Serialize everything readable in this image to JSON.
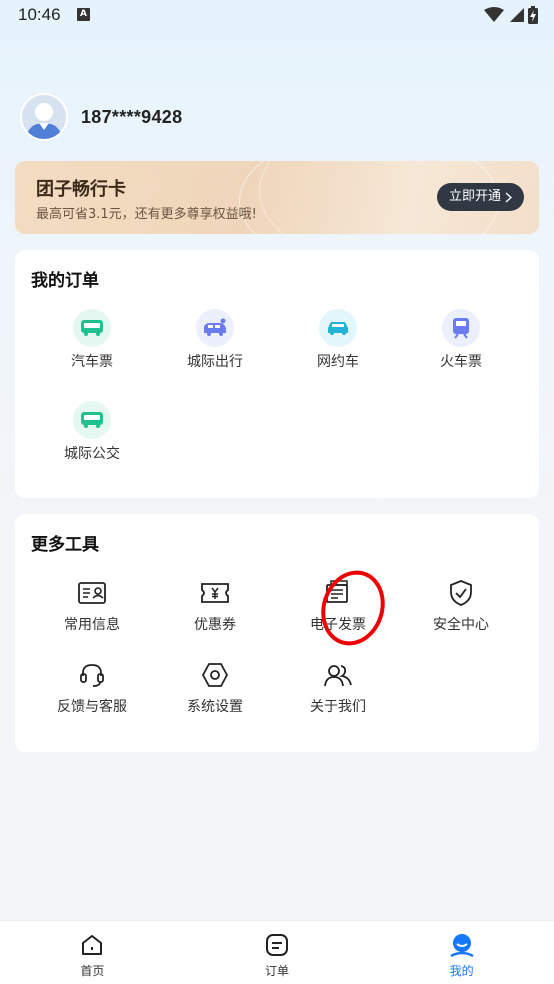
{
  "status": {
    "time": "10:46",
    "notif_letter": "A"
  },
  "profile": {
    "phone": "187****9428"
  },
  "membership": {
    "title": "团子畅行卡",
    "subtitle": "最高可省3.1元，还有更多尊享权益哦!",
    "button": "立即开通"
  },
  "orders": {
    "title": "我的订单",
    "items": [
      {
        "label": "汽车票",
        "icon": "bus-icon",
        "color": "#1fc28f"
      },
      {
        "label": "城际出行",
        "icon": "intercity-van-icon",
        "color": "#6a7bf0"
      },
      {
        "label": "网约车",
        "icon": "car-icon",
        "color": "#22b4d6"
      },
      {
        "label": "火车票",
        "icon": "train-icon",
        "color": "#6a7bf0"
      },
      {
        "label": "城际公交",
        "icon": "bus-icon",
        "color": "#1fc28f"
      }
    ]
  },
  "tools": {
    "title": "更多工具",
    "items": [
      {
        "label": "常用信息",
        "icon": "id-card-icon"
      },
      {
        "label": "优惠券",
        "icon": "coupon-icon"
      },
      {
        "label": "电子发票",
        "icon": "invoice-icon"
      },
      {
        "label": "安全中心",
        "icon": "shield-icon"
      },
      {
        "label": "反馈与客服",
        "icon": "headset-icon"
      },
      {
        "label": "系统设置",
        "icon": "settings-icon"
      },
      {
        "label": "关于我们",
        "icon": "people-icon"
      }
    ]
  },
  "tabbar": {
    "items": [
      {
        "label": "首页",
        "icon": "home-icon"
      },
      {
        "label": "订单",
        "icon": "orders-icon"
      },
      {
        "label": "我的",
        "icon": "profile-icon",
        "active": true
      }
    ],
    "active_color": "#1677ff"
  }
}
